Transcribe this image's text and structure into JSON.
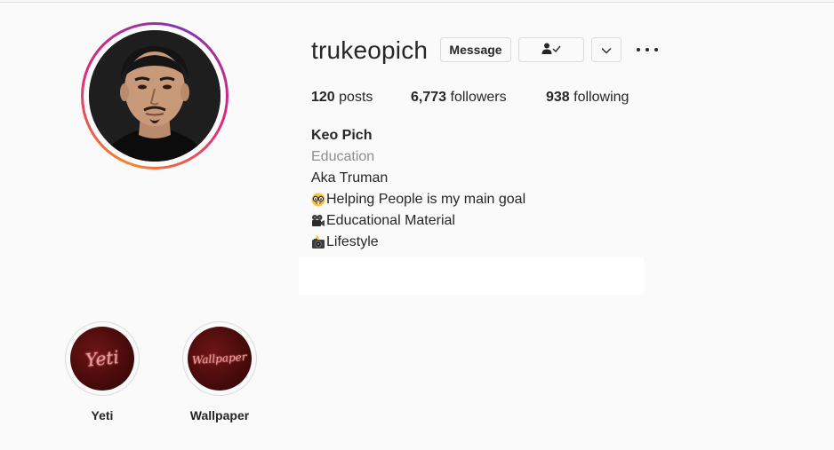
{
  "profile": {
    "username": "trukeopich",
    "message_label": "Message",
    "follow_icon": "person-check-icon",
    "suggest_icon": "chevron-down-icon",
    "more_icon": "more-horizontal-icon"
  },
  "stats": {
    "posts_count": "120",
    "posts_label": "posts",
    "followers_count": "6,773",
    "followers_label": "followers",
    "following_count": "938",
    "following_label": "following"
  },
  "bio": {
    "name": "Keo Pich",
    "category": "Education",
    "lines": [
      {
        "emoji": "",
        "text": "Aka Truman"
      },
      {
        "emoji": "nerd-face-emoji",
        "text": "Helping People is my main goal"
      },
      {
        "emoji": "video-camera-emoji",
        "text": "Educational Material"
      },
      {
        "emoji": "camera-flash-emoji",
        "text": "Lifestyle"
      }
    ]
  },
  "highlights": [
    {
      "label": "Yeti",
      "cover_text": "Yeti"
    },
    {
      "label": "Wallpaper",
      "cover_text": "Wallpaper"
    }
  ],
  "colors": {
    "text": "#262626",
    "secondary": "#8e8e8e",
    "border": "#dbdbdb",
    "background": "#fafafa",
    "story_ring_start": "#f58529",
    "story_ring_end": "#dd2a7b"
  }
}
